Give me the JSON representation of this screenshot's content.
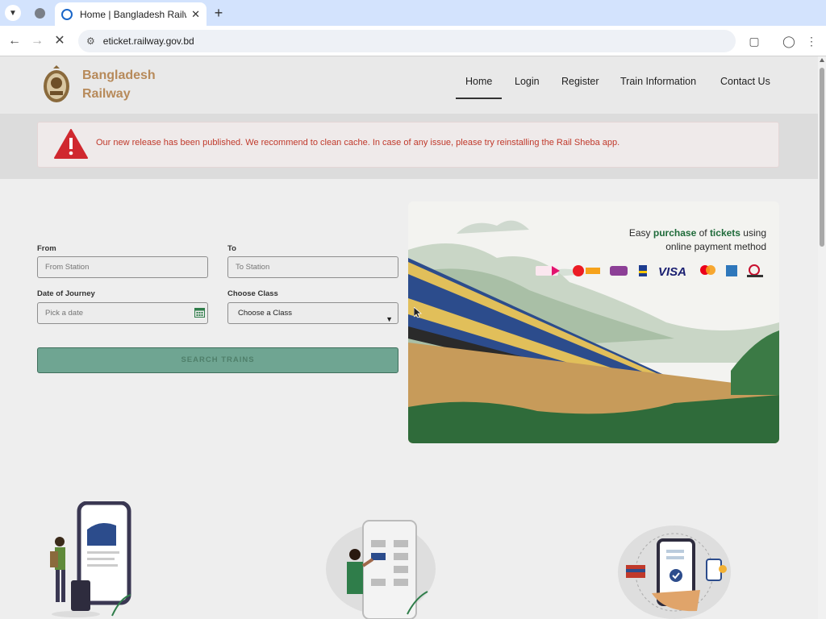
{
  "browser": {
    "tab_title": "Home | Bangladesh Railway",
    "url": "eticket.railway.gov.bd"
  },
  "header": {
    "brand_line1": "Bangladesh",
    "brand_line2": "Railway",
    "nav": [
      "Home",
      "Login",
      "Register",
      "Train Information",
      "Contact Us"
    ],
    "active_nav": "Home"
  },
  "alert": {
    "message": "Our new release has been published. We recommend to clean cache. In case of any issue, please try reinstalling the Rail Sheba app."
  },
  "search_form": {
    "from_label": "From",
    "from_placeholder": "From Station",
    "to_label": "To",
    "to_placeholder": "To Station",
    "date_label": "Date of Journey",
    "date_placeholder": "Pick a date",
    "class_label": "Choose Class",
    "class_selected": "Choose a Class",
    "search_button": "SEARCH TRAINS"
  },
  "banner": {
    "line1_pre": "Easy ",
    "line1_b1": "purchase",
    "line1_mid": " of ",
    "line1_b2": "tickets",
    "line1_post": " using",
    "line2": "online payment method",
    "payment_methods": [
      "bKash",
      "Nagad",
      "Rocket",
      "Upay",
      "VISA",
      "Mastercard",
      "American Express",
      "Nexus Pay"
    ]
  },
  "colors": {
    "brand": "#b78a5a",
    "alert_text": "#c0392b",
    "search_button": "#6fa592",
    "highlight": "#1f6b3a"
  }
}
